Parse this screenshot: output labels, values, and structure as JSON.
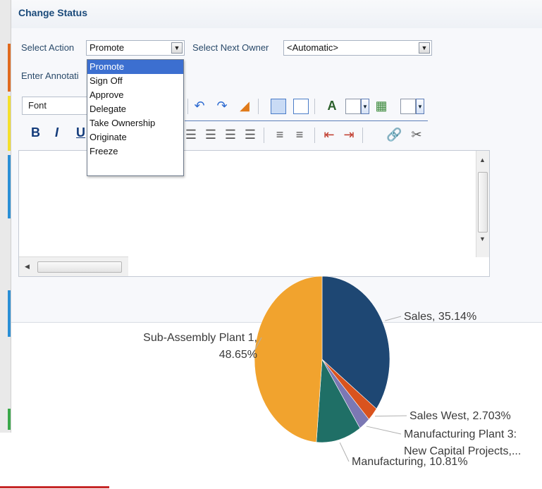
{
  "panel": {
    "title": "Change Status"
  },
  "action": {
    "label": "Select Action",
    "value": "Promote"
  },
  "owner": {
    "label": "Select Next Owner",
    "value": "<Automatic>"
  },
  "annotation": {
    "label": "Enter Annotati"
  },
  "dropdown": {
    "options": [
      "Promote",
      "Sign Off",
      "Approve",
      "Delegate",
      "Take Ownership",
      "Originate",
      "Freeze"
    ],
    "selected": "Promote"
  },
  "toolbar": {
    "font_value": "Font",
    "bold": "B",
    "italic": "I",
    "underline": "U"
  },
  "chart_data": {
    "type": "pie",
    "slices": [
      {
        "label": "Sales, 35.14%",
        "value": 35.14,
        "color": "#1e4773"
      },
      {
        "label": "Sales West, 2.703%",
        "value": 2.703,
        "color": "#d9531e"
      },
      {
        "label": "Manufacturing Plant 3: New Capital Projects,...",
        "value": 2.703,
        "color": "#7b78b4"
      },
      {
        "label": "Manufacturing, 10.81%",
        "value": 10.81,
        "color": "#1f6f66"
      },
      {
        "label": "Sub-Assembly Plant 1, 48.65%",
        "value": 48.65,
        "color": "#f1a32e"
      }
    ],
    "label_lines": [
      [
        "Sales, 35.14%"
      ],
      [
        "Sales West, 2.703%"
      ],
      [
        "Manufacturing Plant 3:",
        "New Capital Projects,..."
      ],
      [
        "Manufacturing, 10.81%"
      ],
      [
        "Sub-Assembly Plant 1,",
        "48.65%"
      ]
    ]
  }
}
